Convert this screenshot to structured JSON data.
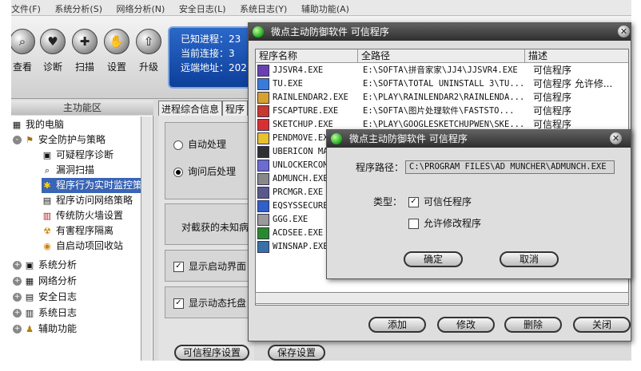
{
  "menu": [
    "文件(F)",
    "系统分析(S)",
    "网络分析(N)",
    "安全日志(L)",
    "系统日志(Y)",
    "辅助功能(A)"
  ],
  "toolbar": [
    {
      "label": "查看",
      "icon": "search-icon"
    },
    {
      "label": "诊断",
      "icon": "heart-icon"
    },
    {
      "label": "扫描",
      "icon": "scan-icon"
    },
    {
      "label": "设置",
      "icon": "hand-icon"
    },
    {
      "label": "升级",
      "icon": "upgrade-icon"
    }
  ],
  "status": {
    "known_processes": "已知进程：23",
    "current_connections": "当前连接：3",
    "remote_address": "远端地址：202"
  },
  "left_panel": {
    "title": "主功能区",
    "tree": [
      {
        "label": "我的电脑",
        "level": 0,
        "expander": "-",
        "icon": "computer-icon"
      },
      {
        "label": "安全防护与策略",
        "level": 1,
        "expander": "-",
        "icon": "shield-icon"
      },
      {
        "label": "可疑程序诊断",
        "level": 2,
        "icon": "diagnose-icon"
      },
      {
        "label": "漏洞扫描",
        "level": 2,
        "icon": "magnifier-icon"
      },
      {
        "label": "程序行为实时监控策",
        "level": 2,
        "icon": "monitor-icon",
        "selected": true
      },
      {
        "label": "程序访问网络策略",
        "level": 2,
        "icon": "network-icon"
      },
      {
        "label": "传统防火墙设置",
        "level": 2,
        "icon": "firewall-icon"
      },
      {
        "label": "有害程序隔离",
        "level": 2,
        "icon": "quarantine-icon"
      },
      {
        "label": "自启动项回收站",
        "level": 2,
        "icon": "recycle-icon"
      },
      {
        "label": "系统分析",
        "level": 1,
        "expander": "+",
        "icon": "system-icon"
      },
      {
        "label": "网络分析",
        "level": 1,
        "expander": "+",
        "icon": "net-icon"
      },
      {
        "label": "安全日志",
        "level": 1,
        "expander": "+",
        "icon": "log-icon"
      },
      {
        "label": "系统日志",
        "level": 1,
        "expander": "+",
        "icon": "syslog-icon"
      },
      {
        "label": "辅助功能",
        "level": 1,
        "expander": "+",
        "icon": "tools-icon"
      }
    ]
  },
  "mid_panel": {
    "tabs": [
      "进程综合信息",
      "程序"
    ],
    "radio_auto": "自动处理",
    "radio_ask": "询问后处理",
    "unknown_text": "对截获的未知病",
    "chk_startup": "显示启动界面",
    "chk_tray": "显示动态托盘",
    "btn_trusted": "可信程序设置",
    "btn_save": "保存设置"
  },
  "dialog1": {
    "title": "微点主动防御软件  可信程序",
    "columns": [
      "程序名称",
      "全路径",
      "描述"
    ],
    "rows": [
      {
        "name": "JJSVR4.EXE",
        "path": "E:\\SOFTA\\拼音家家\\JJ4\\JJSVR4.EXE",
        "desc": "可信程序",
        "color": "#6a3fb0"
      },
      {
        "name": "TU.EXE",
        "path": "E:\\SOFTA\\TOTAL UNINSTALL 3\\TU...",
        "desc": "可信程序 允许修...",
        "color": "#3a7ad8"
      },
      {
        "name": "RAINLENDAR2.EXE",
        "path": "E:\\PLAY\\RAINLENDAR2\\RAINLENDA...",
        "desc": "可信程序",
        "color": "#d8a030"
      },
      {
        "name": "FSCAPTURE.EXE",
        "path": "E:\\SOFTA\\图片处理软件\\FASTSTO...",
        "desc": "可信程序",
        "color": "#c8382c"
      },
      {
        "name": "SKETCHUP.EXE",
        "path": "E:\\PLAY\\GOOGLESKETCHUPWEN\\SKE...",
        "desc": "可信程序",
        "color": "#d83030"
      },
      {
        "name": "PENDMOVE.EXE",
        "path": "",
        "desc": "",
        "color": "#e8c030"
      },
      {
        "name": "UBERICON MAN",
        "path": "",
        "desc": "",
        "color": "#303030"
      },
      {
        "name": "UNLOCKERCOM",
        "path": "",
        "desc": "",
        "color": "#6b6bd0"
      },
      {
        "name": "ADMUNCH.EXE",
        "path": "",
        "desc": "",
        "color": "#888888"
      },
      {
        "name": "PRCMGR.EXE",
        "path": "",
        "desc": "",
        "color": "#5a5a8a"
      },
      {
        "name": "EQSYSSECURE.",
        "path": "",
        "desc": "",
        "color": "#3060c8"
      },
      {
        "name": "GGG.EXE",
        "path": "",
        "desc": "",
        "color": "#9a9a9a"
      },
      {
        "name": "ACDSEE.EXE",
        "path": "",
        "desc": "",
        "color": "#2a8a2a"
      },
      {
        "name": "WINSNAP.EXE",
        "path": "",
        "desc": "",
        "color": "#3a70a8"
      }
    ],
    "buttons": [
      "添加",
      "修改",
      "删除",
      "关闭"
    ]
  },
  "dialog2": {
    "title": "微点主动防御软件  可信程序",
    "path_label": "程序路径：",
    "path_value": "C:\\PROGRAM FILES\\AD MUNCHER\\ADMUNCH.EXE",
    "type_label": "类型：",
    "chk_trusted": "可信任程序",
    "chk_allow_modify": "允许修改程序",
    "ok": "确定",
    "cancel": "取消"
  }
}
